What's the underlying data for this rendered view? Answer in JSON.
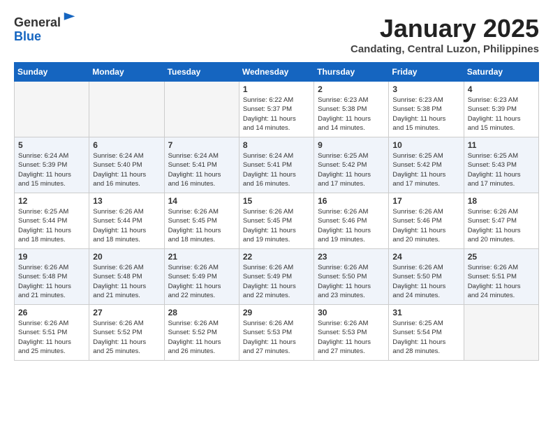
{
  "logo": {
    "general": "General",
    "blue": "Blue"
  },
  "title": "January 2025",
  "location": "Candating, Central Luzon, Philippines",
  "weekdays": [
    "Sunday",
    "Monday",
    "Tuesday",
    "Wednesday",
    "Thursday",
    "Friday",
    "Saturday"
  ],
  "weeks": [
    [
      {
        "day": "",
        "info": ""
      },
      {
        "day": "",
        "info": ""
      },
      {
        "day": "",
        "info": ""
      },
      {
        "day": "1",
        "info": "Sunrise: 6:22 AM\nSunset: 5:37 PM\nDaylight: 11 hours\nand 14 minutes."
      },
      {
        "day": "2",
        "info": "Sunrise: 6:23 AM\nSunset: 5:38 PM\nDaylight: 11 hours\nand 14 minutes."
      },
      {
        "day": "3",
        "info": "Sunrise: 6:23 AM\nSunset: 5:38 PM\nDaylight: 11 hours\nand 15 minutes."
      },
      {
        "day": "4",
        "info": "Sunrise: 6:23 AM\nSunset: 5:39 PM\nDaylight: 11 hours\nand 15 minutes."
      }
    ],
    [
      {
        "day": "5",
        "info": "Sunrise: 6:24 AM\nSunset: 5:39 PM\nDaylight: 11 hours\nand 15 minutes."
      },
      {
        "day": "6",
        "info": "Sunrise: 6:24 AM\nSunset: 5:40 PM\nDaylight: 11 hours\nand 16 minutes."
      },
      {
        "day": "7",
        "info": "Sunrise: 6:24 AM\nSunset: 5:41 PM\nDaylight: 11 hours\nand 16 minutes."
      },
      {
        "day": "8",
        "info": "Sunrise: 6:24 AM\nSunset: 5:41 PM\nDaylight: 11 hours\nand 16 minutes."
      },
      {
        "day": "9",
        "info": "Sunrise: 6:25 AM\nSunset: 5:42 PM\nDaylight: 11 hours\nand 17 minutes."
      },
      {
        "day": "10",
        "info": "Sunrise: 6:25 AM\nSunset: 5:42 PM\nDaylight: 11 hours\nand 17 minutes."
      },
      {
        "day": "11",
        "info": "Sunrise: 6:25 AM\nSunset: 5:43 PM\nDaylight: 11 hours\nand 17 minutes."
      }
    ],
    [
      {
        "day": "12",
        "info": "Sunrise: 6:25 AM\nSunset: 5:44 PM\nDaylight: 11 hours\nand 18 minutes."
      },
      {
        "day": "13",
        "info": "Sunrise: 6:26 AM\nSunset: 5:44 PM\nDaylight: 11 hours\nand 18 minutes."
      },
      {
        "day": "14",
        "info": "Sunrise: 6:26 AM\nSunset: 5:45 PM\nDaylight: 11 hours\nand 18 minutes."
      },
      {
        "day": "15",
        "info": "Sunrise: 6:26 AM\nSunset: 5:45 PM\nDaylight: 11 hours\nand 19 minutes."
      },
      {
        "day": "16",
        "info": "Sunrise: 6:26 AM\nSunset: 5:46 PM\nDaylight: 11 hours\nand 19 minutes."
      },
      {
        "day": "17",
        "info": "Sunrise: 6:26 AM\nSunset: 5:46 PM\nDaylight: 11 hours\nand 20 minutes."
      },
      {
        "day": "18",
        "info": "Sunrise: 6:26 AM\nSunset: 5:47 PM\nDaylight: 11 hours\nand 20 minutes."
      }
    ],
    [
      {
        "day": "19",
        "info": "Sunrise: 6:26 AM\nSunset: 5:48 PM\nDaylight: 11 hours\nand 21 minutes."
      },
      {
        "day": "20",
        "info": "Sunrise: 6:26 AM\nSunset: 5:48 PM\nDaylight: 11 hours\nand 21 minutes."
      },
      {
        "day": "21",
        "info": "Sunrise: 6:26 AM\nSunset: 5:49 PM\nDaylight: 11 hours\nand 22 minutes."
      },
      {
        "day": "22",
        "info": "Sunrise: 6:26 AM\nSunset: 5:49 PM\nDaylight: 11 hours\nand 22 minutes."
      },
      {
        "day": "23",
        "info": "Sunrise: 6:26 AM\nSunset: 5:50 PM\nDaylight: 11 hours\nand 23 minutes."
      },
      {
        "day": "24",
        "info": "Sunrise: 6:26 AM\nSunset: 5:50 PM\nDaylight: 11 hours\nand 24 minutes."
      },
      {
        "day": "25",
        "info": "Sunrise: 6:26 AM\nSunset: 5:51 PM\nDaylight: 11 hours\nand 24 minutes."
      }
    ],
    [
      {
        "day": "26",
        "info": "Sunrise: 6:26 AM\nSunset: 5:51 PM\nDaylight: 11 hours\nand 25 minutes."
      },
      {
        "day": "27",
        "info": "Sunrise: 6:26 AM\nSunset: 5:52 PM\nDaylight: 11 hours\nand 25 minutes."
      },
      {
        "day": "28",
        "info": "Sunrise: 6:26 AM\nSunset: 5:52 PM\nDaylight: 11 hours\nand 26 minutes."
      },
      {
        "day": "29",
        "info": "Sunrise: 6:26 AM\nSunset: 5:53 PM\nDaylight: 11 hours\nand 27 minutes."
      },
      {
        "day": "30",
        "info": "Sunrise: 6:26 AM\nSunset: 5:53 PM\nDaylight: 11 hours\nand 27 minutes."
      },
      {
        "day": "31",
        "info": "Sunrise: 6:25 AM\nSunset: 5:54 PM\nDaylight: 11 hours\nand 28 minutes."
      },
      {
        "day": "",
        "info": ""
      }
    ]
  ]
}
